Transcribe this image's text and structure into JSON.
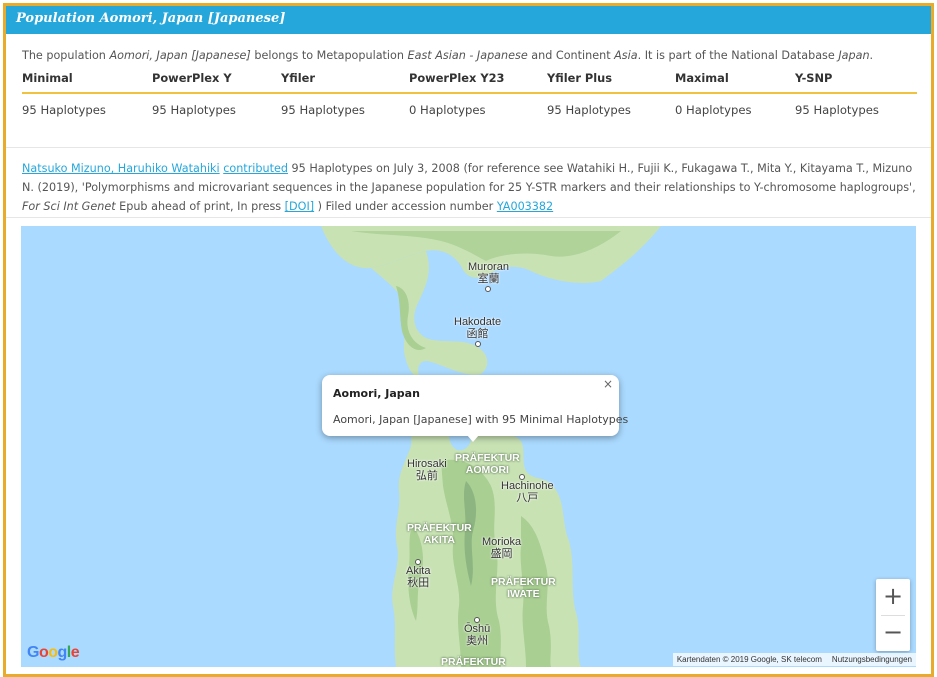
{
  "header": {
    "title": "Population Aomori, Japan [Japanese]"
  },
  "description": {
    "p1": "The population ",
    "pop_name": "Aomori, Japan [Japanese]",
    "p2": " belongs to Metapopulation ",
    "metapop": "East Asian - Japanese",
    "p3": " and Continent ",
    "continent": "Asia",
    "p4": ". It is part of the National Database ",
    "database": "Japan",
    "p5": "."
  },
  "haplotypes": {
    "headers": [
      "Minimal",
      "PowerPlex Y",
      "Yfiler",
      "PowerPlex Y23",
      "Yfiler Plus",
      "Maximal",
      "Y-SNP"
    ],
    "values": [
      "95 Haplotypes",
      "95 Haplotypes",
      "95 Haplotypes",
      "0 Haplotypes",
      "95 Haplotypes",
      "0 Haplotypes",
      "95 Haplotypes"
    ]
  },
  "contribution": {
    "authors": "Natsuko Mizuno, Haruhiko Watahiki",
    "contributed": "contributed",
    "text1": " 95 Haplotypes on July 3, 2008 (for reference see Watahiki H., Fujii K., Fukagawa T., Mita Y., Kitayama T., Mizuno N. (2019), 'Polymorphisms and microvariant sequences in the Japanese population for 25 Y-STR markers and their relationships to Y-chromosome haplogroups', ",
    "journal": "For Sci Int Genet",
    "text2": " Epub ahead of print, In press ",
    "doi": "[DOI]",
    "text3": " ) Filed under accession number ",
    "accession": "YA003382"
  },
  "map": {
    "popup": {
      "title": "Aomori, Japan",
      "body": "Aomori, Japan [Japanese] with 95 Minimal Haplotypes",
      "close": "×"
    },
    "zoom_in": "+",
    "zoom_out": "−",
    "google_logo": "Google",
    "attribution": "Kartendaten © 2019 Google, SK telecom",
    "terms": "Nutzungsbedingungen",
    "labels": {
      "muroran": "Muroran",
      "muroran_jp": "室蘭",
      "hakodate": "Hakodate",
      "hakodate_jp": "函館",
      "hirosaki": "Hirosaki",
      "hirosaki_jp": "弘前",
      "aomori_pref_1": "PRÄFEKTUR",
      "aomori_pref_2": "AOMORI",
      "hachinohe": "Hachinohe",
      "hachinohe_jp": "八戸",
      "akita_pref_1": "PRÄFEKTUR",
      "akita_pref_2": "AKITA",
      "morioka": "Morioka",
      "morioka_jp": "盛岡",
      "akita": "Akita",
      "akita_jp": "秋田",
      "iwate_pref_1": "PRÄFEKTUR",
      "iwate_pref_2": "IWATE",
      "oshu": "Ōshū",
      "oshu_jp": "奥州",
      "bottom_pref": "PRÄFEKTUR"
    },
    "colors": {
      "water": "#aadaff",
      "land": "#c8e2b4",
      "forest": "#a9cf92",
      "mountain": "#8db581"
    }
  },
  "colors": {
    "header_bg": "#25a7db",
    "frame_border": "#e8ab2a",
    "table_rule": "#f0c23e",
    "link": "#25a7db"
  }
}
